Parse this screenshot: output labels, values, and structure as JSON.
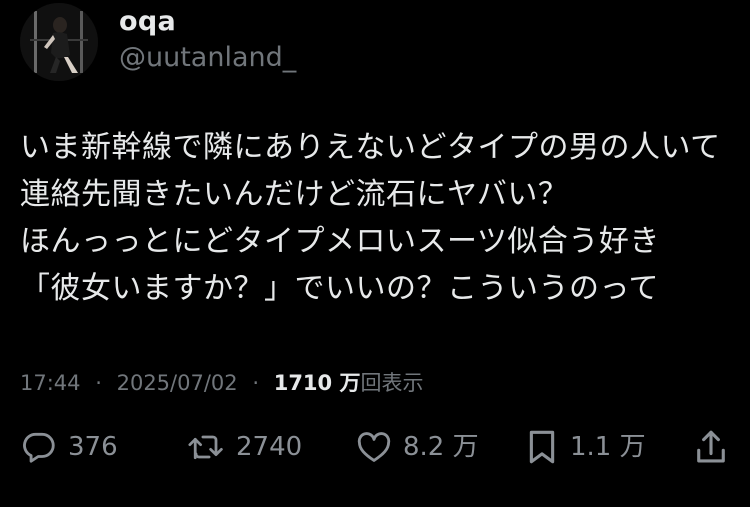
{
  "author": {
    "display_name": "oqa",
    "handle": "@uutanland_"
  },
  "tweet": {
    "lines": [
      "いま新幹線で隣にありえないどタイプの男の人いて",
      "連絡先聞きたいんだけど流石にヤバい？",
      "ほんっっとにどタイプメロいスーツ似合う好き",
      "「彼女いますか？」でいいの？こういうのって"
    ]
  },
  "meta": {
    "time": "17:44",
    "separator": "·",
    "date": "2025/07/02",
    "views_count": "1710 万",
    "views_label": "回表示"
  },
  "actions": {
    "reply_count": "376",
    "retweet_count": "2740",
    "like_count": "8.2 万",
    "bookmark_count": "1.1 万"
  },
  "colors": {
    "background": "#000000",
    "primary_text": "#e7e9ea",
    "secondary_text": "#71767b"
  },
  "icons": [
    "reply-icon",
    "retweet-icon",
    "like-icon",
    "bookmark-icon",
    "share-icon"
  ]
}
